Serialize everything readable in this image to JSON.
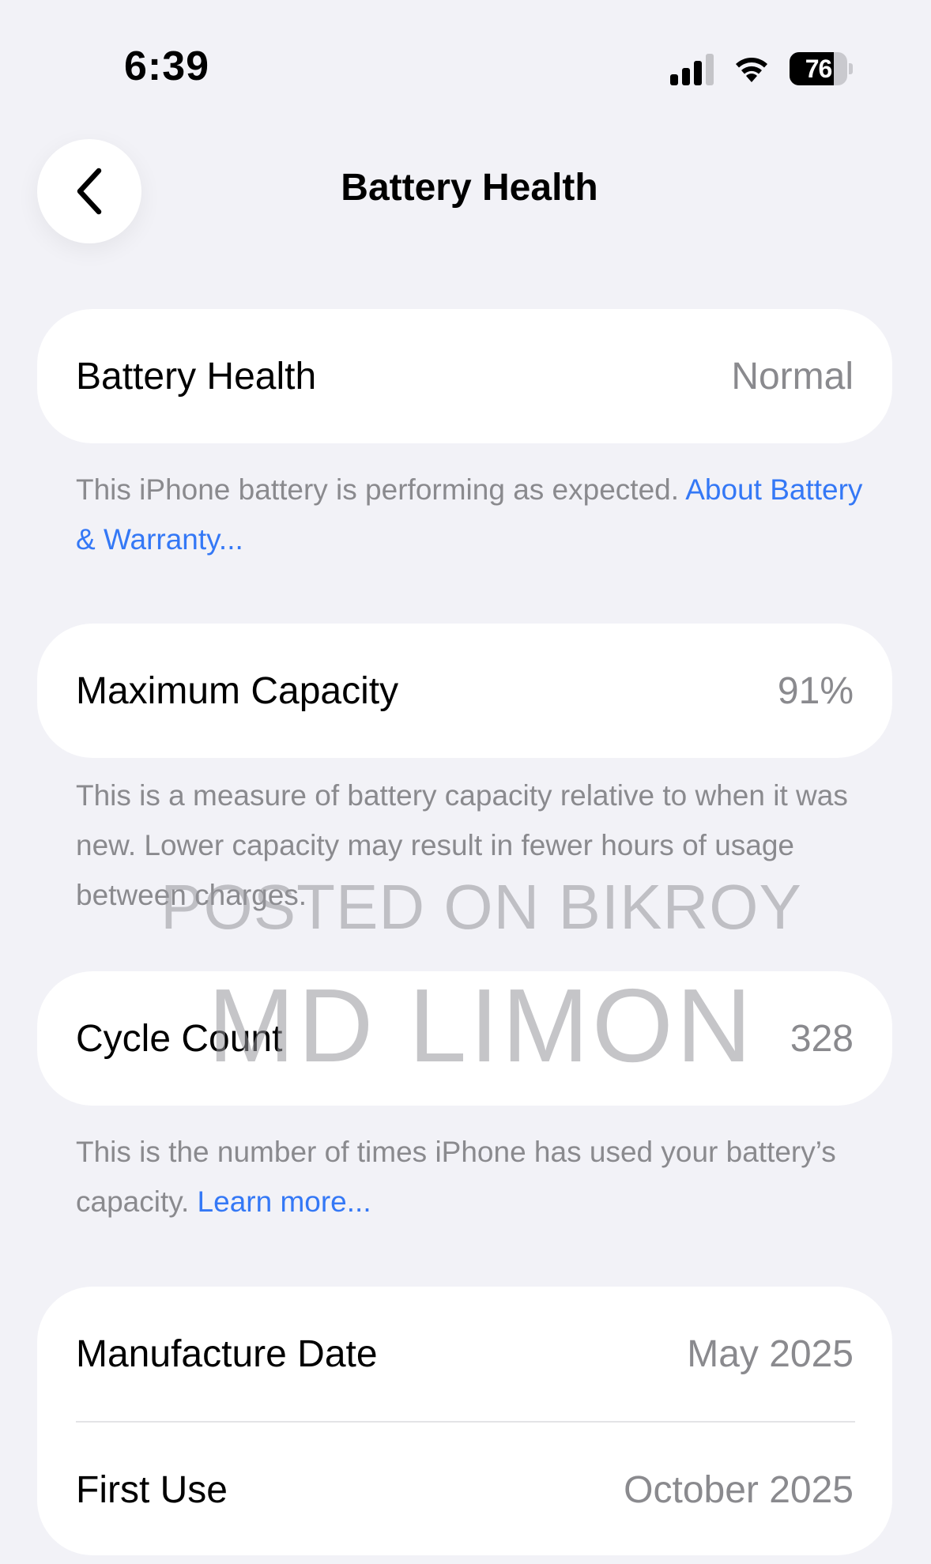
{
  "status_bar": {
    "time": "6:39",
    "battery_level": "76",
    "battery_percent": 76,
    "signal_bars_total": 4,
    "signal_bars_active": 3,
    "icons": [
      "signal-icon",
      "wifi-icon",
      "battery-icon"
    ]
  },
  "nav": {
    "title": "Battery Health",
    "back_icon": "chevron-left-icon"
  },
  "battery_health": {
    "label": "Battery Health",
    "value": "Normal",
    "footnote_text": "This iPhone battery is performing as expected. ",
    "footnote_link": "About Battery & Warranty..."
  },
  "maximum_capacity": {
    "label": "Maximum Capacity",
    "value": "91%",
    "footnote_text": "This is a measure of battery capacity relative to when it was new. Lower capacity may result in fewer hours of usage between charges."
  },
  "cycle_count": {
    "label": "Cycle Count",
    "value": "328",
    "footnote_text": "This is the number of times iPhone has used your battery’s capacity. ",
    "footnote_link": "Learn more..."
  },
  "dates": {
    "manufacture_label": "Manufacture Date",
    "manufacture_value": "May 2025",
    "first_use_label": "First Use",
    "first_use_value": "October 2025"
  },
  "watermark": {
    "line1": "POSTED ON BIKROY",
    "line2": "MD LIMON"
  },
  "colors": {
    "background": "#f2f2f7",
    "card": "#ffffff",
    "secondary_text": "#8a8a8e",
    "link": "#3478f6"
  }
}
